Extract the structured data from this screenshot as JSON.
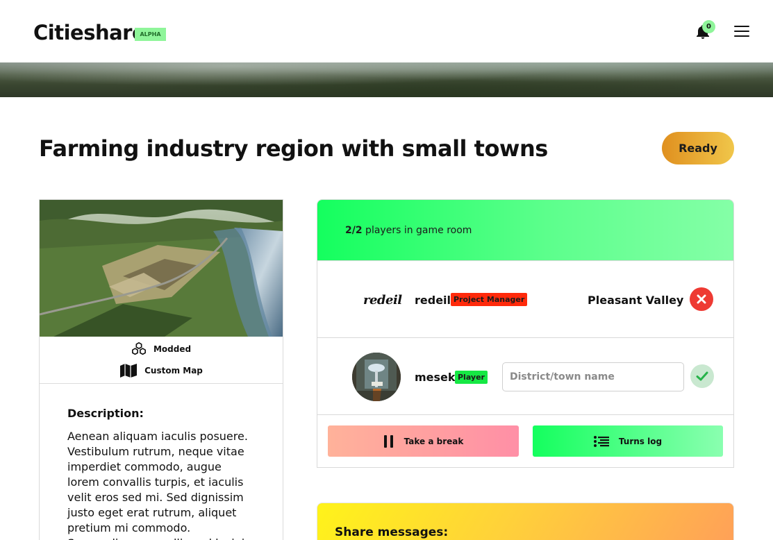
{
  "header": {
    "brand": "Citieshare",
    "badge": "ALPHA",
    "notification_count": "0"
  },
  "page": {
    "title": "Farming industry region with small towns",
    "ready_label": "Ready"
  },
  "map_card": {
    "tags": [
      {
        "icon": "cubes-icon",
        "label": "Modded"
      },
      {
        "icon": "map-icon",
        "label": "Custom Map"
      }
    ],
    "description_title": "Description:",
    "description_text": "Aenean aliquam iaculis posuere. Vestibulum rutrum, neque vitae imperdiet commodo, augue lorem convallis turpis, et iaculis velit eros sed mi. Sed dignissim justo eget erat rutrum, aliquet pretium mi commodo. Suspendisse convallis sed lacinia nunc, iaculis. Etiam eget"
  },
  "game_room": {
    "count_strong": "2/2",
    "count_text": " players in game room",
    "players": [
      {
        "signature": "redeil",
        "name": "redeil",
        "role": "Project Manager",
        "town": "Pleasant Valley"
      },
      {
        "name": "mesek",
        "role": "Player",
        "town_placeholder": "District/town name"
      }
    ],
    "break_label": "Take a break",
    "log_label": "Turns log"
  },
  "share": {
    "title": "Share messages:"
  },
  "colors": {
    "accent_green": "#14ff5e",
    "reject_red": "#ee3a33",
    "ready_orange": "#e0901f",
    "badge_pm": "#ff2a0b",
    "badge_player": "#16e844"
  }
}
